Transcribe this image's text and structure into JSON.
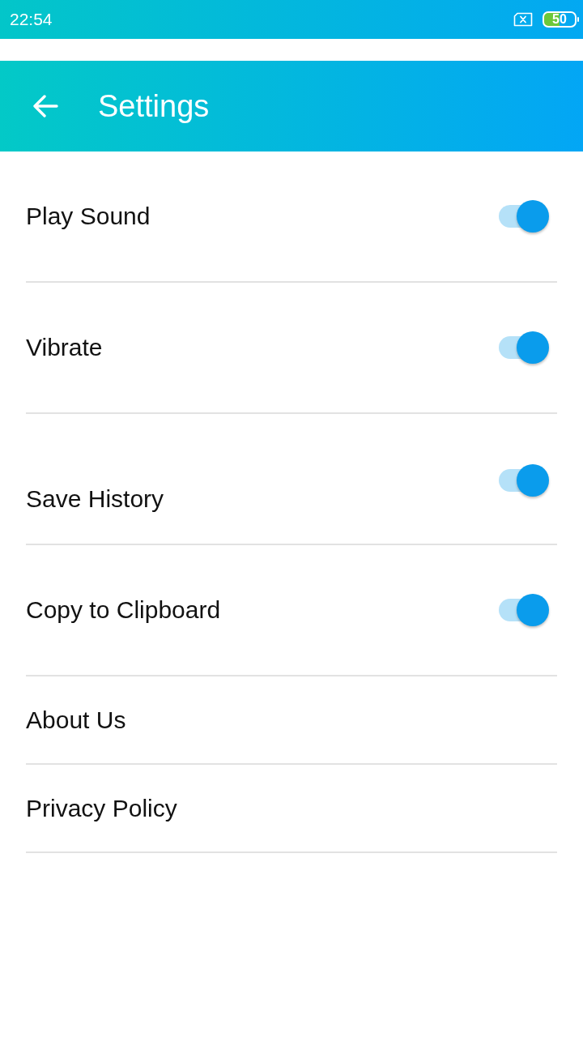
{
  "status_bar": {
    "time": "22:54",
    "battery": "50"
  },
  "app_bar": {
    "title": "Settings"
  },
  "settings": [
    {
      "kind": "toggle",
      "label": "Play Sound",
      "on": true
    },
    {
      "kind": "toggle",
      "label": "Vibrate",
      "on": true
    },
    {
      "kind": "toggle",
      "label": "Save History",
      "on": true
    },
    {
      "kind": "toggle",
      "label": "Copy to Clipboard",
      "on": true
    },
    {
      "kind": "link",
      "label": "About Us"
    },
    {
      "kind": "link",
      "label": "Privacy Policy"
    }
  ]
}
